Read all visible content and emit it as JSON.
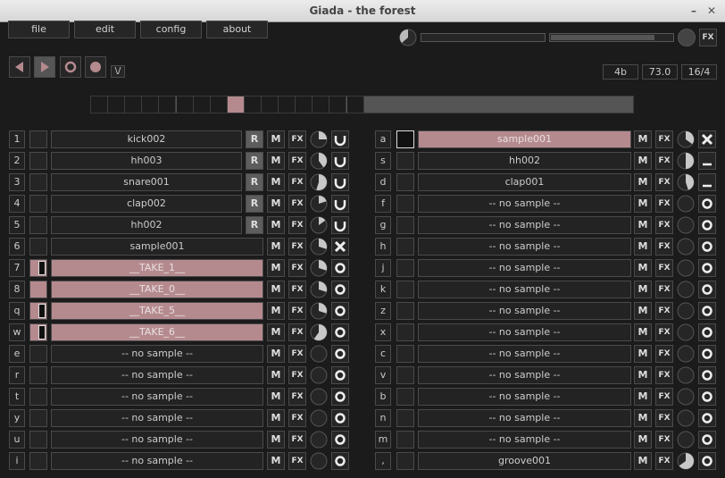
{
  "window": {
    "title": "Giada - the forest",
    "minimize": "–",
    "close": "✕"
  },
  "menu": [
    "file",
    "edit",
    "config",
    "about"
  ],
  "mixer": {
    "fx_label": "FX"
  },
  "transport": {
    "grid_label": "\\/",
    "beats": "4b",
    "bpm": "73.0",
    "meter": "16/4"
  },
  "beat_meter": {
    "total": 16,
    "current": 8
  },
  "left_channels": [
    {
      "key": "1",
      "label": "kick002",
      "led": "empty",
      "rec": "R",
      "vol": 0.25,
      "mode": "loop",
      "active": false
    },
    {
      "key": "2",
      "label": "hh003",
      "led": "empty",
      "rec": "R",
      "vol": 0.4,
      "mode": "loop",
      "active": false
    },
    {
      "key": "3",
      "label": "snare001",
      "led": "empty",
      "rec": "R",
      "vol": 0.55,
      "mode": "loop",
      "active": false
    },
    {
      "key": "4",
      "label": "clap002",
      "led": "empty",
      "rec": "R",
      "vol": 0.2,
      "mode": "loop",
      "active": false
    },
    {
      "key": "5",
      "label": "hh002",
      "led": "empty",
      "rec": "R",
      "vol": 0.15,
      "mode": "loop",
      "active": false
    },
    {
      "key": "6",
      "label": "sample001",
      "led": "empty",
      "rec": "",
      "vol": 0.3,
      "mode": "x",
      "active": false
    },
    {
      "key": "7",
      "label": "__TAKE_1__",
      "led": "bar",
      "rec": "",
      "vol": 0.3,
      "mode": "ring",
      "active": true
    },
    {
      "key": "8",
      "label": "__TAKE_0__",
      "led": "pink",
      "rec": "",
      "vol": 0.3,
      "mode": "ring",
      "active": true
    },
    {
      "key": "q",
      "label": "__TAKE_5__",
      "led": "bar",
      "rec": "",
      "vol": 0.3,
      "mode": "ring",
      "active": true
    },
    {
      "key": "w",
      "label": "__TAKE_6__",
      "led": "bar",
      "rec": "",
      "vol": 0.6,
      "mode": "ring",
      "active": true
    },
    {
      "key": "e",
      "label": "-- no sample --",
      "led": "empty",
      "rec": "",
      "vol": 0,
      "mode": "ring",
      "active": false
    },
    {
      "key": "r",
      "label": "-- no sample --",
      "led": "empty",
      "rec": "",
      "vol": 0,
      "mode": "ring",
      "active": false
    },
    {
      "key": "t",
      "label": "-- no sample --",
      "led": "empty",
      "rec": "",
      "vol": 0,
      "mode": "ring",
      "active": false
    },
    {
      "key": "y",
      "label": "-- no sample --",
      "led": "empty",
      "rec": "",
      "vol": 0,
      "mode": "ring",
      "active": false
    },
    {
      "key": "u",
      "label": "-- no sample --",
      "led": "empty",
      "rec": "",
      "vol": 0,
      "mode": "ring",
      "active": false
    },
    {
      "key": "i",
      "label": "-- no sample --",
      "led": "empty",
      "rec": "",
      "vol": 0,
      "mode": "ring",
      "active": false
    }
  ],
  "right_channels": [
    {
      "key": "a",
      "label": "sample001",
      "led": "outlined",
      "vol": 0.35,
      "mode": "x",
      "active": true
    },
    {
      "key": "s",
      "label": "hh002",
      "led": "empty",
      "vol": 0.5,
      "mode": "oneshot",
      "active": false
    },
    {
      "key": "d",
      "label": "clap001",
      "led": "empty",
      "vol": 0.45,
      "mode": "oneshot",
      "active": false
    },
    {
      "key": "f",
      "label": "-- no sample --",
      "led": "empty",
      "vol": 0,
      "mode": "ring",
      "active": false
    },
    {
      "key": "g",
      "label": "-- no sample --",
      "led": "empty",
      "vol": 0,
      "mode": "ring",
      "active": false
    },
    {
      "key": "h",
      "label": "-- no sample --",
      "led": "empty",
      "vol": 0,
      "mode": "ring",
      "active": false
    },
    {
      "key": "j",
      "label": "-- no sample --",
      "led": "empty",
      "vol": 0,
      "mode": "ring",
      "active": false
    },
    {
      "key": "k",
      "label": "-- no sample --",
      "led": "empty",
      "vol": 0,
      "mode": "ring",
      "active": false
    },
    {
      "key": "z",
      "label": "-- no sample --",
      "led": "empty",
      "vol": 0,
      "mode": "ring",
      "active": false
    },
    {
      "key": "x",
      "label": "-- no sample --",
      "led": "empty",
      "vol": 0,
      "mode": "ring",
      "active": false
    },
    {
      "key": "c",
      "label": "-- no sample --",
      "led": "empty",
      "vol": 0,
      "mode": "ring",
      "active": false
    },
    {
      "key": "v",
      "label": "-- no sample --",
      "led": "empty",
      "vol": 0,
      "mode": "ring",
      "active": false
    },
    {
      "key": "b",
      "label": "-- no sample --",
      "led": "empty",
      "vol": 0,
      "mode": "ring",
      "active": false
    },
    {
      "key": "n",
      "label": "-- no sample --",
      "led": "empty",
      "vol": 0,
      "mode": "ring",
      "active": false
    },
    {
      "key": "m",
      "label": "-- no sample --",
      "led": "empty",
      "vol": 0,
      "mode": "ring",
      "active": false
    },
    {
      "key": ",",
      "label": "groove001",
      "led": "empty",
      "vol": 0.65,
      "mode": "ring",
      "active": false
    }
  ],
  "buttons": {
    "mute": "M",
    "fx": "FX"
  },
  "colors": {
    "active": "#b58a8f",
    "background": "#1b1b1b"
  }
}
